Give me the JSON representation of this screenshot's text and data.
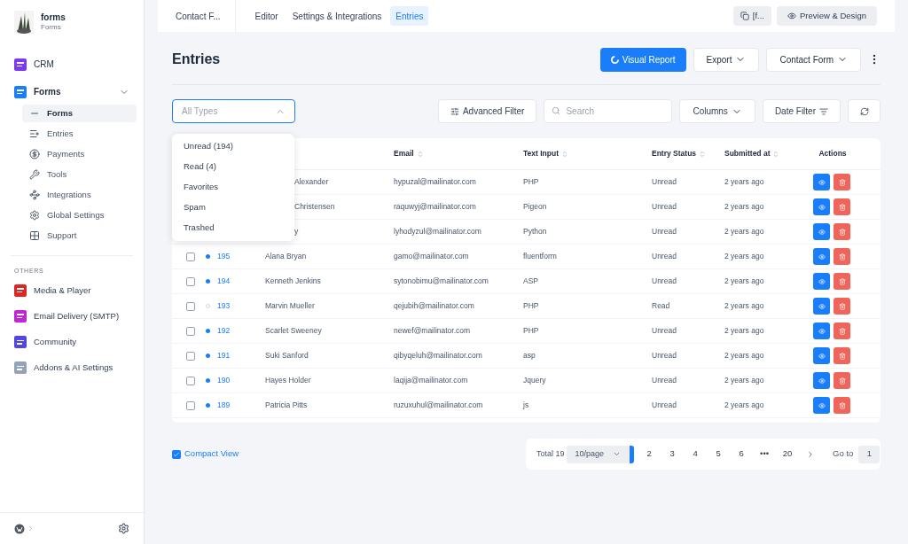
{
  "site": {
    "title": "forms",
    "subtitle": "Forms"
  },
  "sidebar": {
    "items": [
      {
        "label": "CRM",
        "kind": "crm",
        "expanded": false
      },
      {
        "label": "Forms",
        "kind": "forms",
        "expanded": true,
        "children": [
          {
            "label": "Forms",
            "kind": "list",
            "selected": true
          },
          {
            "label": "Entries",
            "kind": "entries",
            "selected": false
          },
          {
            "label": "Payments",
            "kind": "payments",
            "selected": false
          },
          {
            "label": "Tools",
            "kind": "tools",
            "selected": false
          },
          {
            "label": "Integrations",
            "kind": "integrations",
            "selected": false
          },
          {
            "label": "Global Settings",
            "kind": "settings",
            "selected": false
          },
          {
            "label": "Support",
            "kind": "support",
            "selected": false
          }
        ]
      }
    ],
    "section_label": "OTHERS",
    "others": [
      {
        "label": "Media & Player",
        "kind": "media"
      },
      {
        "label": "Email Delivery (SMTP)",
        "kind": "smtp"
      },
      {
        "label": "Community",
        "kind": "community"
      },
      {
        "label": "Addons & AI Settings",
        "kind": "addons"
      }
    ]
  },
  "topbar": {
    "form_name": "Contact F...",
    "tabs": [
      {
        "label": "Editor",
        "selected": false
      },
      {
        "label": "Settings & Integrations",
        "selected": false
      },
      {
        "label": "Entries",
        "selected": true
      }
    ],
    "shortcode": "[f...",
    "preview": "Preview & Design"
  },
  "page": {
    "title": "Entries",
    "visual_report": "Visual Report",
    "export": "Export",
    "form_select": "Contact Form"
  },
  "filters": {
    "type_placeholder": "All Types",
    "type_options": [
      "Unread (194)",
      "Read (4)",
      "Favorites",
      "Spam",
      "Trashed"
    ],
    "advanced_filter": "Advanced Filter",
    "search_placeholder": "Search",
    "columns": "Columns",
    "date_filter": "Date Filter"
  },
  "table": {
    "columns": [
      "Email",
      "Text Input",
      "Entry Status",
      "Submitted at",
      "Actions"
    ],
    "rows": [
      {
        "covered": true,
        "name": "Alexander",
        "email": "hypuzal@mailinator.com",
        "text": "PHP",
        "status": "Unread",
        "submitted": "2 years ago"
      },
      {
        "covered": true,
        "name": "Christensen",
        "email": "raquwyj@mailinator.com",
        "text": "Pigeon",
        "status": "Unread",
        "submitted": "2 years ago"
      },
      {
        "covered": true,
        "name": "y",
        "email": "lyhodyzul@mailinator.com",
        "text": "Python",
        "status": "Unread",
        "submitted": "2 years ago"
      },
      {
        "covered": false,
        "id": "195",
        "checked": false,
        "read": false,
        "name": "Alana Bryan",
        "email": "gamo@mailinator.com",
        "text": "fluentform",
        "status": "Unread",
        "submitted": "2 years ago"
      },
      {
        "covered": false,
        "id": "194",
        "checked": false,
        "read": false,
        "name": "Kenneth Jenkins",
        "email": "sytonobimu@mailinator.com",
        "text": "ASP",
        "status": "Unread",
        "submitted": "2 years ago"
      },
      {
        "covered": false,
        "id": "193",
        "checked": false,
        "read": true,
        "name": "Marvin Mueller",
        "email": "qejubih@mailinator.com",
        "text": "PHP",
        "status": "Read",
        "submitted": "2 years ago"
      },
      {
        "covered": false,
        "id": "192",
        "checked": false,
        "read": false,
        "name": "Scarlet Sweeney",
        "email": "newef@mailinator.com",
        "text": "PHP",
        "status": "Unread",
        "submitted": "2 years ago"
      },
      {
        "covered": false,
        "id": "191",
        "checked": false,
        "read": false,
        "name": "Suki Sanford",
        "email": "qibyqeluh@mailinator.com",
        "text": "asp",
        "status": "Unread",
        "submitted": "2 years ago"
      },
      {
        "covered": false,
        "id": "190",
        "checked": false,
        "read": false,
        "name": "Hayes Holder",
        "email": "laqija@mailinator.com",
        "text": "Jquery",
        "status": "Unread",
        "submitted": "2 years ago"
      },
      {
        "covered": false,
        "id": "189",
        "checked": false,
        "read": false,
        "name": "Patricia Pitts",
        "email": "ruzuxuhul@mailinator.com",
        "text": "js",
        "status": "Unread",
        "submitted": "2 years ago"
      }
    ]
  },
  "compact_view": {
    "label": "Compact View",
    "checked": true
  },
  "pagination": {
    "total": "Total 19",
    "page_size": "10/page",
    "pages": [
      {
        "selected": true
      },
      {
        "label": "2",
        "selected": false
      },
      {
        "label": "3",
        "selected": false
      },
      {
        "label": "4",
        "selected": false
      },
      {
        "label": "5",
        "selected": false
      },
      {
        "label": "6",
        "selected": false
      },
      {
        "label": "•••",
        "selected": false
      },
      {
        "label": "20",
        "selected": false
      }
    ],
    "goto_label": "Go to",
    "goto_value": "1"
  }
}
